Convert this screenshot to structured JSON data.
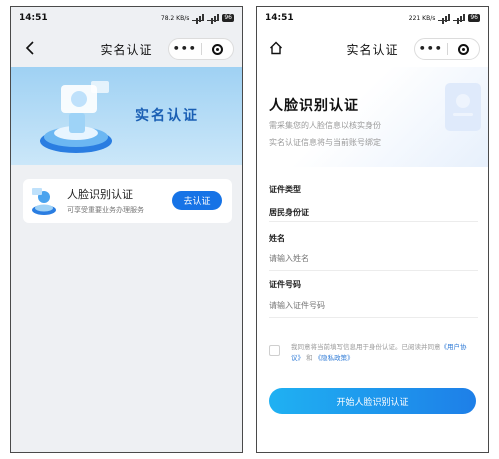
{
  "colors": {
    "primary": "#1673e6",
    "banner_text": "#1a5fb4",
    "link": "#2e7ad6"
  },
  "left": {
    "status": {
      "time": "14:51",
      "net": "78.2 KB/s",
      "battery": "96"
    },
    "nav": {
      "title": "实名认证",
      "more": "•••"
    },
    "banner": {
      "text": "实名认证"
    },
    "face_card": {
      "title": "人脸识别认证",
      "desc": "可享受重要业务办理服务",
      "button": "去认证"
    }
  },
  "right": {
    "status": {
      "time": "14:51",
      "net": "221 KB/s",
      "battery": "96"
    },
    "nav": {
      "title": "实名认证",
      "more": "•••"
    },
    "form": {
      "title": "人脸识别认证",
      "subtitle1": "需采集您的人脸信息以核实身份",
      "subtitle2": "实名认证信息将与当前账号绑定",
      "cert_type_label": "证件类型",
      "cert_type_value": "居民身份证",
      "name_label": "姓名",
      "name_placeholder": "请输入姓名",
      "cert_no_label": "证件号码",
      "cert_no_placeholder": "请输入证件号码"
    },
    "agreement": {
      "text1": "我同意将当前填写信息用于身份认证。已阅读并同意",
      "user_agreement": "《用户协议》",
      "and": "和",
      "privacy_policy": "《隐私政策》"
    },
    "start_button": "开始人脸识别认证"
  }
}
